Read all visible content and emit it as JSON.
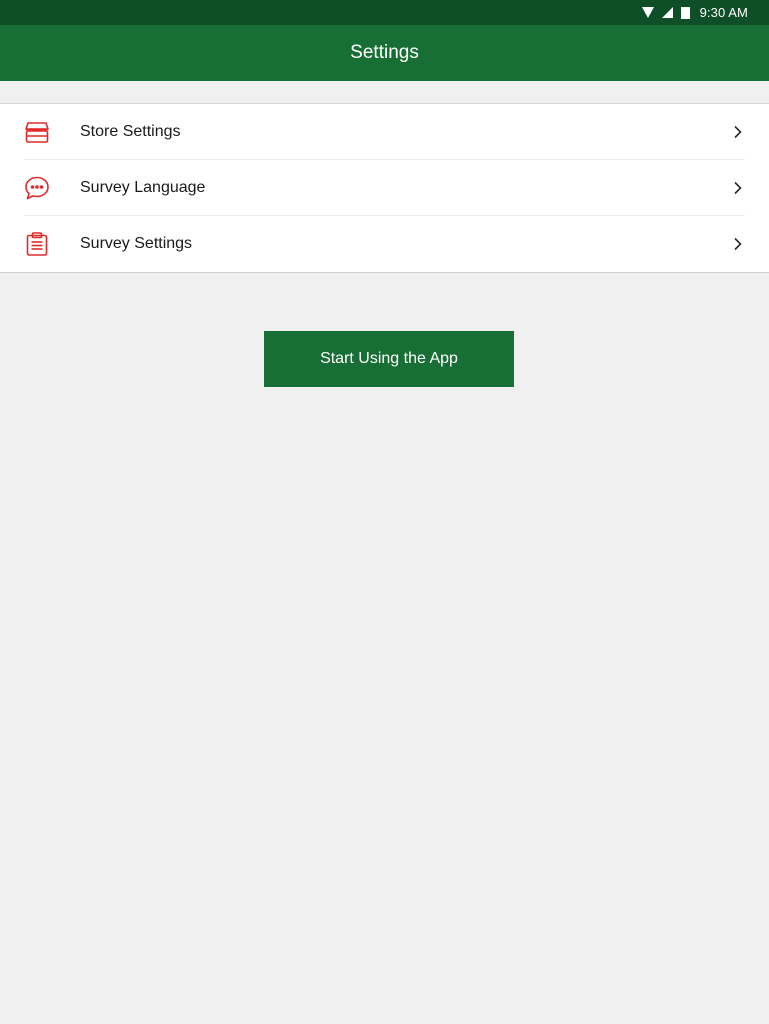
{
  "status_bar": {
    "time": "9:30 AM",
    "icons": [
      "wifi-icon",
      "cell-signal-icon",
      "battery-icon"
    ]
  },
  "app_bar": {
    "title": "Settings"
  },
  "settings_list": {
    "items": [
      {
        "label": "Store Settings",
        "icon": "store-icon"
      },
      {
        "label": "Survey Language",
        "icon": "chat-bubble-icon"
      },
      {
        "label": "Survey Settings",
        "icon": "clipboard-icon"
      }
    ]
  },
  "primary_action": {
    "label": "Start Using the App"
  },
  "colors": {
    "status_bar": "#0f4f27",
    "app_bar": "#186f35",
    "button": "#186f35",
    "icon_accent": "#e02a2a",
    "background": "#f0f0f0"
  }
}
